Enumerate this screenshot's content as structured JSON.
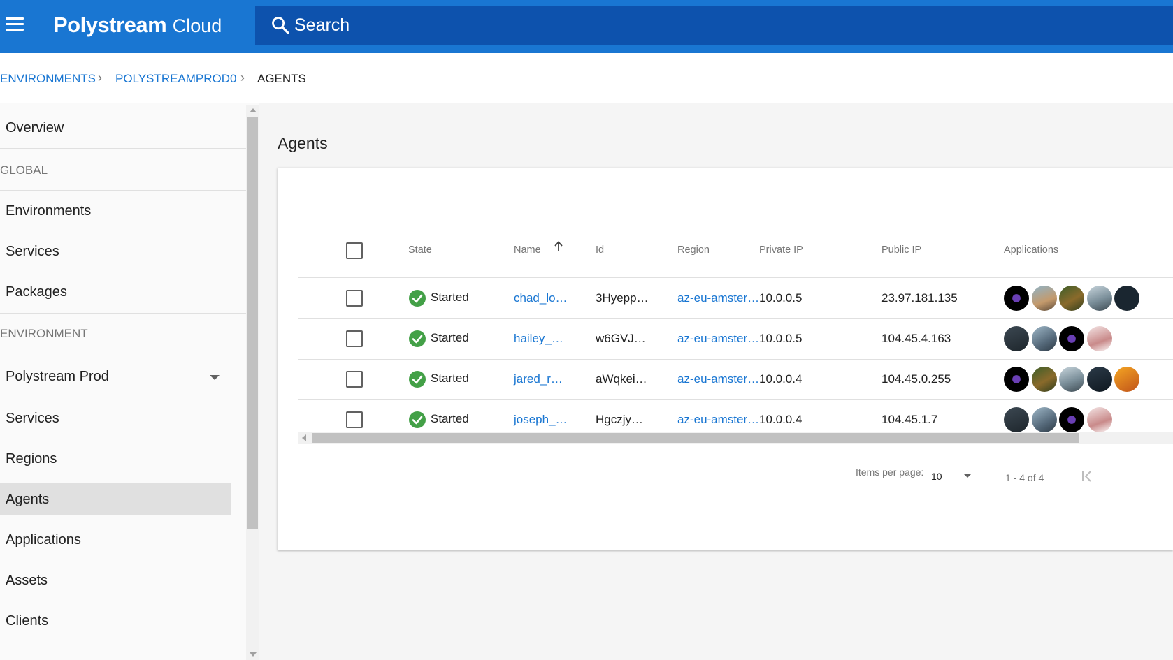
{
  "header": {
    "brand_bold": "Polystream",
    "brand_light": "Cloud",
    "search_placeholder": "Search"
  },
  "breadcrumb": [
    {
      "label": "ENVIRONMENTS"
    },
    {
      "label": "POLYSTREAMPROD0"
    },
    {
      "label": "AGENTS"
    }
  ],
  "sidebar": {
    "overview": "Overview",
    "global_heading": "GLOBAL",
    "global_items": [
      "Environments",
      "Services",
      "Packages"
    ],
    "environment_heading": "ENVIRONMENT",
    "environment_selected": "Polystream Prod",
    "environment_items": [
      "Services",
      "Regions",
      "Agents",
      "Applications",
      "Assets",
      "Clients"
    ],
    "active_item": "Agents"
  },
  "main": {
    "title": "Agents",
    "columns": {
      "state": "State",
      "name": "Name",
      "id": "Id",
      "region": "Region",
      "private_ip": "Private IP",
      "public_ip": "Public IP",
      "applications": "Applications"
    },
    "sort": {
      "column": "Name",
      "direction": "ascending"
    },
    "rows": [
      {
        "state": "Started",
        "name": "chad_lo…",
        "id": "3Hyepp…",
        "region": "az-eu-amster…",
        "private_ip": "10.0.0.5",
        "public_ip": "23.97.181.135",
        "apps": [
          "steam-icon",
          "game-thumb-hunter-icon",
          "game-thumb-jungle-icon",
          "game-thumb-mountain-icon",
          "game-thumb-portal-icon"
        ]
      },
      {
        "state": "Started",
        "name": "hailey_…",
        "id": "w6GVJ…",
        "region": "az-eu-amster…",
        "private_ip": "10.0.0.5",
        "public_ip": "104.45.4.163",
        "apps": [
          "game-thumb-vbs3-icon",
          "game-thumb-aircraft-icon",
          "steam-icon",
          "game-thumb-football-icon"
        ]
      },
      {
        "state": "Started",
        "name": "jared_r…",
        "id": "aWqkei…",
        "region": "az-eu-amster…",
        "private_ip": "10.0.0.4",
        "public_ip": "104.45.0.255",
        "apps": [
          "steam-icon",
          "game-thumb-jungle-icon",
          "game-thumb-mountain-icon",
          "game-thumb-portal2-icon",
          "game-thumb-orange-icon"
        ]
      },
      {
        "state": "Started",
        "name": "joseph_…",
        "id": "Hgczjy…",
        "region": "az-eu-amster…",
        "private_ip": "10.0.0.4",
        "public_ip": "104.45.1.7",
        "apps": [
          "game-thumb-vbs3-icon",
          "game-thumb-aircraft-icon",
          "steam-icon",
          "game-thumb-football-icon"
        ]
      }
    ],
    "pagination": {
      "items_per_page_label": "Items per page:",
      "items_per_page": "10",
      "range": "1 - 4 of 4"
    }
  },
  "colors": {
    "primary": "#1976d2",
    "search_bg": "#0d52ad",
    "started_green": "#43a047"
  }
}
